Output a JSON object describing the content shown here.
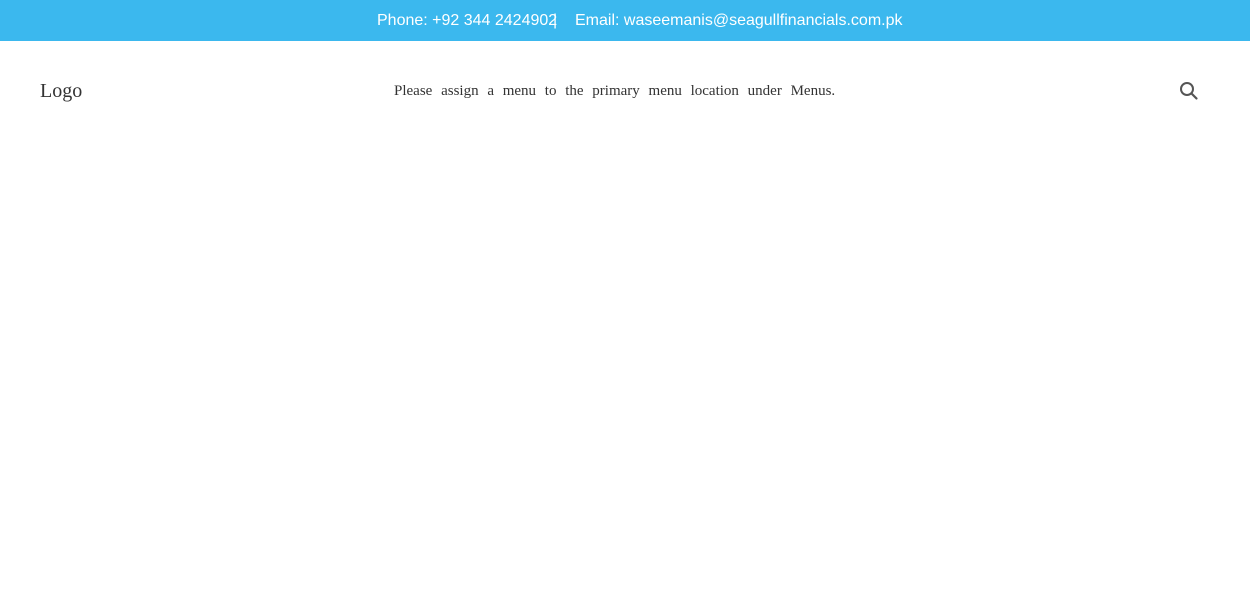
{
  "topbar": {
    "phone": "Phone: +92 344 2424902",
    "separator": "|",
    "email": "Email: waseemanis@seagullfinancials.com.pk"
  },
  "header": {
    "logo": "Logo",
    "menu_notice": "Please assign a menu to the primary menu location under Menus.",
    "search_icon": "search-icon"
  },
  "colors": {
    "topbar_bg": "#3bb8ee",
    "topbar_text": "#ffffff",
    "text": "#333333"
  }
}
